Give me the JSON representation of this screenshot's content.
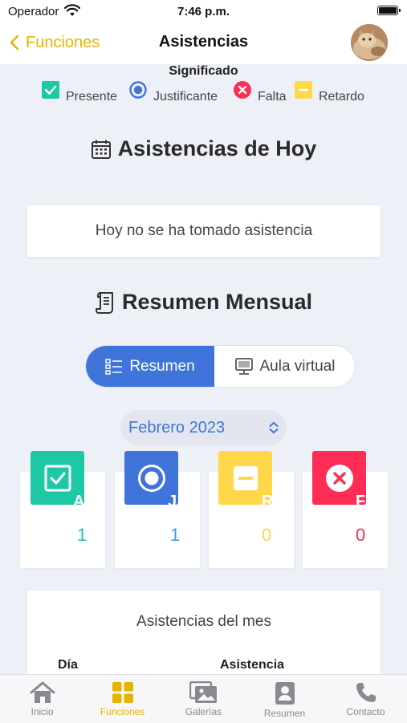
{
  "status": {
    "carrier": "Operador",
    "time": "7:46 p.m."
  },
  "nav": {
    "back_label": "Funciones",
    "title": "Asistencias"
  },
  "legend": {
    "title": "Significado",
    "items": [
      {
        "label": "Presente",
        "color": "#1ec8a5",
        "icon": "check-square-icon"
      },
      {
        "label": "Justificante",
        "color": "#3f74db",
        "icon": "radio-dot-icon"
      },
      {
        "label": "Falta",
        "color": "#ff2d55",
        "icon": "x-circle-icon"
      },
      {
        "label": "Retardo",
        "color": "#ffd84a",
        "icon": "minus-square-icon"
      }
    ]
  },
  "today": {
    "title": "Asistencias de Hoy",
    "message": "Hoy no se ha tomado asistencia"
  },
  "summary": {
    "title": "Resumen Mensual",
    "tabs": [
      {
        "label": "Resumen",
        "active": true
      },
      {
        "label": "Aula virtual",
        "active": false
      }
    ],
    "month": "Febrero 2023",
    "stats": [
      {
        "letter": "A",
        "value": "1",
        "color": "#1ec8a5",
        "icon": "check-icon"
      },
      {
        "letter": "J",
        "value": "1",
        "color": "#3f74db",
        "icon": "radio-dot-icon"
      },
      {
        "letter": "R",
        "value": "0",
        "color": "#ffd84a",
        "icon": "minus-icon"
      },
      {
        "letter": "F",
        "value": "0",
        "color": "#ff2d55",
        "icon": "x-icon"
      }
    ]
  },
  "month_attendance": {
    "title": "Asistencias del mes",
    "col_day": "Día",
    "col_attendance": "Asistencia"
  },
  "tabbar": {
    "items": [
      {
        "label": "Inicio",
        "icon": "home-icon",
        "active": false
      },
      {
        "label": "Funciones",
        "icon": "grid-icon",
        "active": true
      },
      {
        "label": "Galerías",
        "icon": "gallery-icon",
        "active": false
      },
      {
        "label": "Resumen",
        "icon": "profile-card-icon",
        "active": false
      },
      {
        "label": "Contacto",
        "icon": "phone-icon",
        "active": false
      }
    ]
  }
}
